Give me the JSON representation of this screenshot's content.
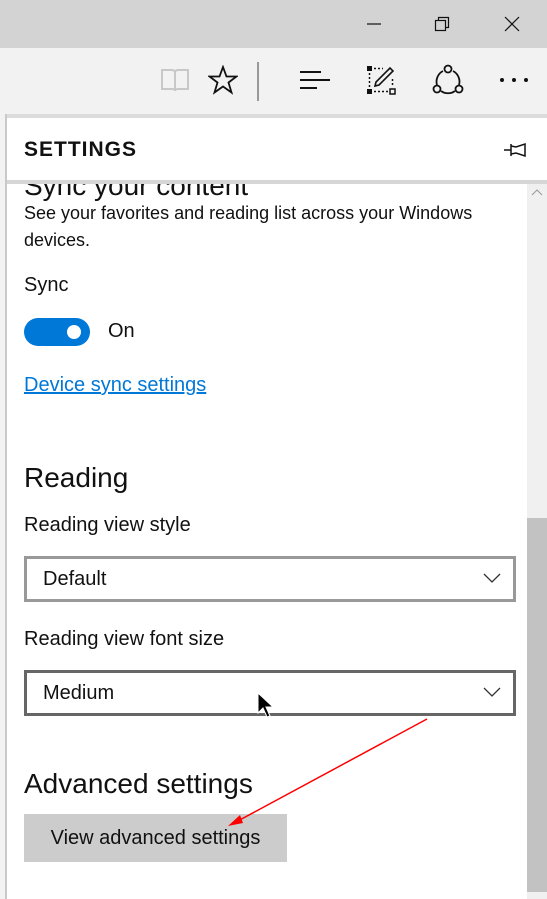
{
  "window": {
    "controls": [
      {
        "name": "minimize-icon",
        "label": "Minimize"
      },
      {
        "name": "restore-icon",
        "label": "Restore"
      },
      {
        "name": "close-icon",
        "label": "Close"
      }
    ]
  },
  "toolbar": {
    "icons": [
      {
        "name": "reading-view-icon",
        "state": "disabled"
      },
      {
        "name": "favorites-star-icon",
        "state": "enabled"
      },
      {
        "name": "hub-icon",
        "state": "enabled"
      },
      {
        "name": "web-note-icon",
        "state": "enabled"
      },
      {
        "name": "share-icon",
        "state": "enabled"
      },
      {
        "name": "more-icon",
        "state": "enabled"
      }
    ]
  },
  "panel": {
    "title": "SETTINGS",
    "pin_icon": "pin-icon",
    "sync_section": {
      "heading": "Sync your content",
      "description": "See your favorites and reading list across your Windows devices.",
      "sync_label": "Sync",
      "toggle_state": "On",
      "toggle_on": true,
      "link": "Device sync settings"
    },
    "reading_section": {
      "heading": "Reading",
      "style_label": "Reading view style",
      "style_value": "Default",
      "font_size_label": "Reading view font size",
      "font_size_value": "Medium"
    },
    "advanced_section": {
      "heading": "Advanced settings",
      "button": "View advanced settings"
    }
  },
  "colors": {
    "accent": "#0078d7",
    "annotation_arrow": "#ff0000",
    "button_bg": "#cccccc",
    "titlebar_bg": "#d3d3d3"
  },
  "annotations": [
    {
      "type": "arrow",
      "color": "#ff0000",
      "points_to": "View advanced settings"
    }
  ]
}
